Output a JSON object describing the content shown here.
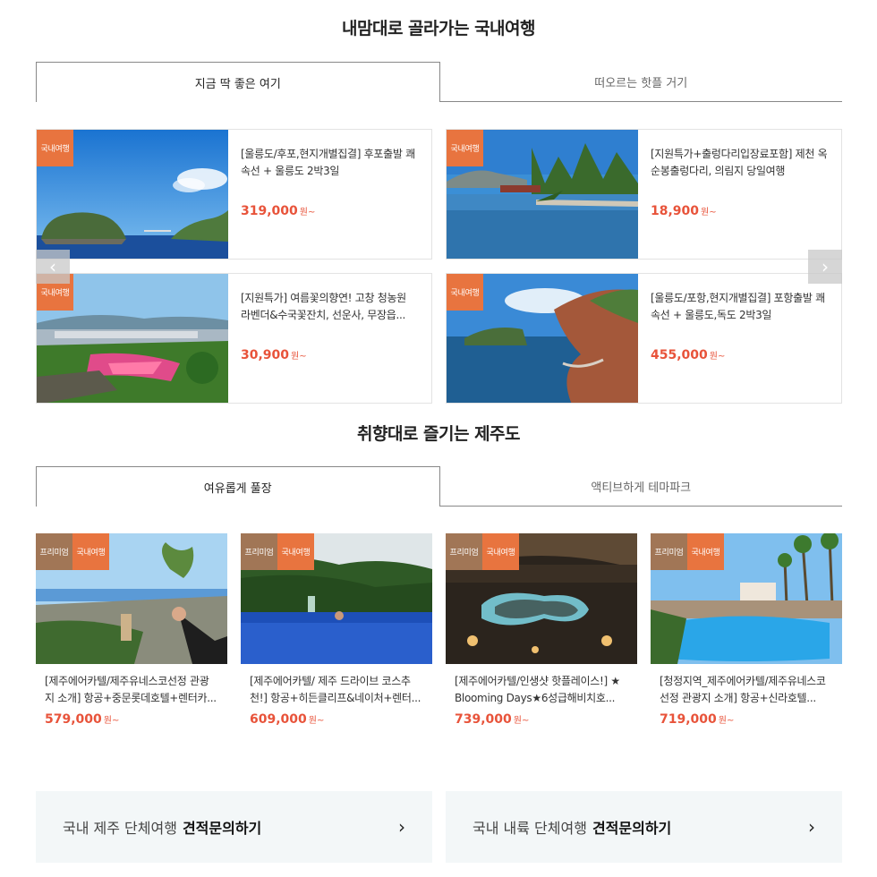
{
  "domestic": {
    "title": "내맘대로 골라가는 국내여행",
    "tabs": [
      "지금 딱 좋은 여기",
      "떠오르는 핫플 거기"
    ],
    "badge": "국내여행",
    "items": [
      {
        "name": "[울릉도/후포,현지개별집결] 후포출발 쾌속선 + 울릉도 2박3일",
        "price": "319,000",
        "won": "원~"
      },
      {
        "name": "[지원특가+출렁다리입장료포함] 제천 옥순봉출렁다리, 의림지 당일여행",
        "price": "18,900",
        "won": "원~"
      },
      {
        "name": "[지원특가] 여름꽃의향연! 고창 청농원 라벤더&수국꽃잔치, 선운사, 무장읍...",
        "price": "30,900",
        "won": "원~"
      },
      {
        "name": "[울릉도/포항,현지개별집결] 포항출발 쾌속선 + 울릉도,독도 2박3일",
        "price": "455,000",
        "won": "원~"
      }
    ],
    "prev_icon": "chevron-left-icon",
    "next_icon": "chevron-right-icon"
  },
  "jeju": {
    "title": "취향대로 즐기는 제주도",
    "tabs": [
      "여유롭게 풀장",
      "액티브하게 테마파크"
    ],
    "badge_premium": "프리미엄",
    "badge_domestic": "국내여행",
    "items": [
      {
        "name": "[제주에어카텔/제주유네스코선정 관광지 소개] 항공+중문롯데호텔+렌터카...",
        "price": "579,000",
        "won": "원~"
      },
      {
        "name": "[제주에어카텔/ 제주 드라이브 코스추천!] 항공+히든클리프&네이처+렌터...",
        "price": "609,000",
        "won": "원~"
      },
      {
        "name": "[제주에어카텔/인생샷 핫플레이스!] ★ Blooming Days★6성급해비치호...",
        "price": "739,000",
        "won": "원~"
      },
      {
        "name": "[청정지역_제주에어카텔/제주유네스코선정 관광지 소개] 항공+신라호텔...",
        "price": "719,000",
        "won": "원~"
      }
    ]
  },
  "inquiry": [
    {
      "label": "국내 제주 단체여행",
      "bold": "견적문의하기"
    },
    {
      "label": "국내 내륙 단체여행",
      "bold": "견적문의하기"
    }
  ],
  "colors": {
    "accent": "#e8533a",
    "badge_orange": "#e8743f",
    "badge_brown": "#a17656"
  }
}
